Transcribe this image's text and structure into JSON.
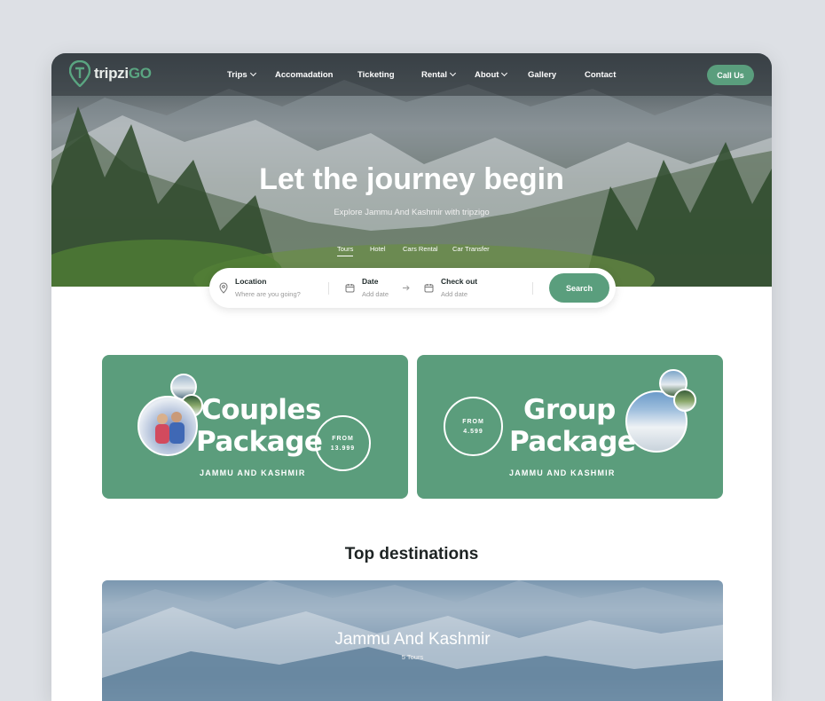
{
  "brand": {
    "logo_prefix": "tripzi",
    "logo_suffix": "GO"
  },
  "nav": {
    "items": [
      {
        "label": "Trips",
        "dropdown": true
      },
      {
        "label": "Accomadation",
        "dropdown": false
      },
      {
        "label": "Ticketing",
        "dropdown": false
      },
      {
        "label": "Rental",
        "dropdown": true
      },
      {
        "label": "About",
        "dropdown": true
      },
      {
        "label": "Gallery",
        "dropdown": false
      },
      {
        "label": "Contact",
        "dropdown": false
      }
    ],
    "cta": "Call Us"
  },
  "hero": {
    "title": "Let the journey begin",
    "subtitle": "Explore Jammu And Kashmir with tripzigo",
    "tabs": [
      "Tours",
      "Hotel",
      "Cars Rental",
      "Car Transfer"
    ],
    "active_tab": "Tours"
  },
  "search": {
    "location": {
      "label": "Location",
      "placeholder": "Where are you going?"
    },
    "date": {
      "label": "Date",
      "placeholder": "Add date"
    },
    "checkout": {
      "label": "Check out",
      "placeholder": "Add date"
    },
    "button": "Search"
  },
  "promos": {
    "couples": {
      "title_line1": "Couples",
      "title_line2": "Package",
      "subtitle": "JAMMU AND KASHMIR",
      "from_label": "FROM",
      "price": "13.999"
    },
    "group": {
      "title_line1": "Group",
      "title_line2": "Package",
      "subtitle": "JAMMU AND KASHMIR",
      "from_label": "FROM",
      "price": "4.599"
    }
  },
  "destinations": {
    "heading": "Top destinations",
    "items": [
      {
        "name": "Jammu And Kashmir",
        "count": "5 Tours"
      }
    ]
  },
  "colors": {
    "accent": "#5a9e7d",
    "promo_bg": "#5b9d7c",
    "heading": "#1e2424",
    "page_bg": "#dde0e5"
  }
}
